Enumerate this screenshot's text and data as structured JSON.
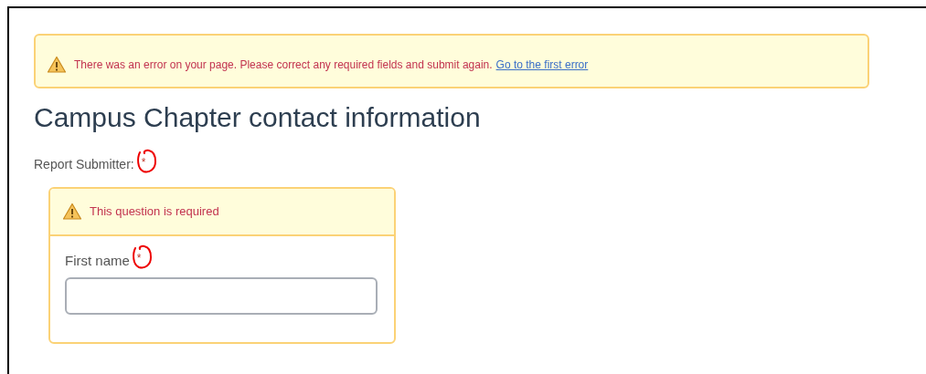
{
  "error_banner": {
    "message": "There was an error on your page. Please correct any required fields and submit again.",
    "link": "Go to the first error"
  },
  "heading": "Campus Chapter contact information",
  "question": {
    "label": "Report Submitter:",
    "required_mark": {
      "text": "*",
      "circled": true
    },
    "error": "This question is required",
    "fields": [
      {
        "label": "First name",
        "required_mark": {
          "text": "*",
          "circled": true
        }
      }
    ]
  }
}
